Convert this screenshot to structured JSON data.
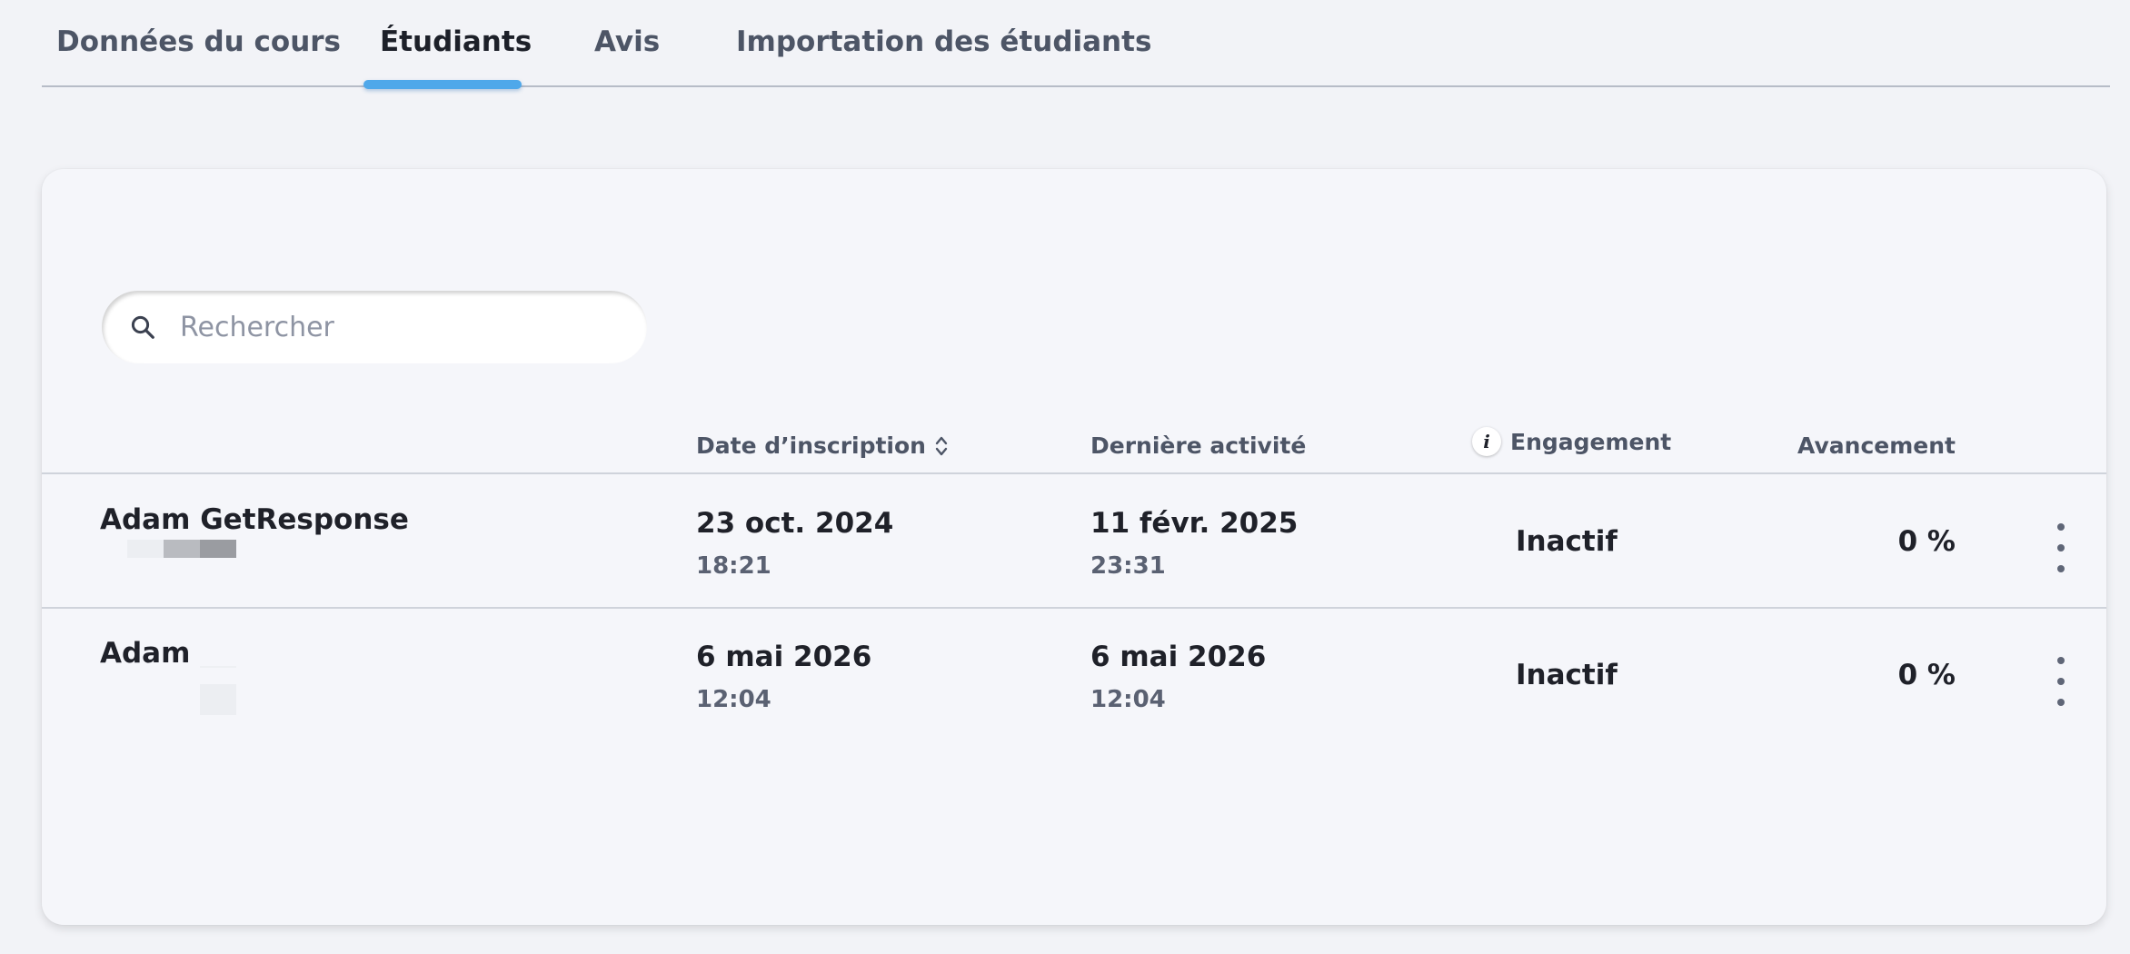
{
  "tabs": [
    {
      "label": "Données du cours"
    },
    {
      "label": "Étudiants"
    },
    {
      "label": "Avis"
    },
    {
      "label": "Importation des étudiants"
    }
  ],
  "active_tab": "Étudiants",
  "search": {
    "placeholder": "Rechercher",
    "value": ""
  },
  "table": {
    "columns": {
      "signup_date": "Date d’inscription",
      "last_activity": "Dernière activité",
      "engagement": "Engagement",
      "progress": "Avancement"
    },
    "rows": [
      {
        "name": "Adam GetResponse",
        "signup_date": "23 oct. 2024",
        "signup_time": "18:21",
        "last_activity_date": "11 févr. 2025",
        "last_activity_time": "23:31",
        "engagement": "Inactif",
        "progress": "0 %"
      },
      {
        "name": "Adam",
        "signup_date": "6 mai 2026",
        "signup_time": "12:04",
        "last_activity_date": "6 mai 2026",
        "last_activity_time": "12:04",
        "engagement": "Inactif",
        "progress": "0 %"
      }
    ]
  },
  "icons": {
    "search": "search-icon",
    "sort": "sort-icon",
    "info": "info-icon",
    "row_menu": "more-vertical-icon"
  },
  "colors": {
    "accent": "#4fa8ea",
    "background": "#f2f3f7",
    "card": "#f5f6fa"
  }
}
